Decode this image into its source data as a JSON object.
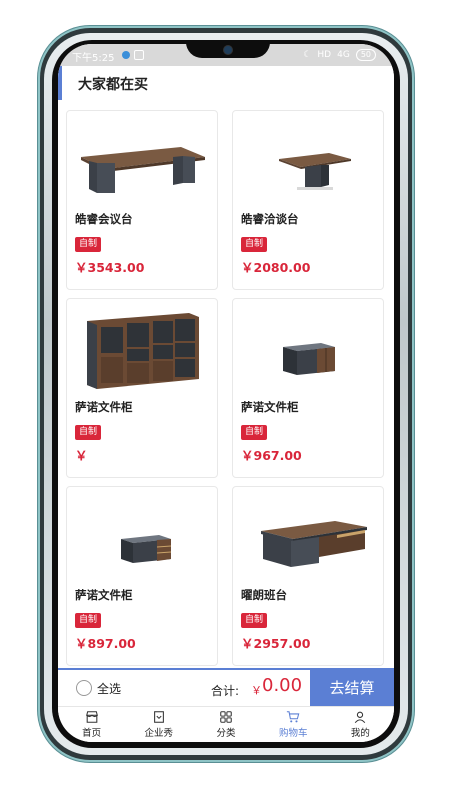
{
  "status_bar": {
    "time": "下午5:25",
    "network": "HD",
    "signal": "4G",
    "battery": "50"
  },
  "section": {
    "title": "大家都在买"
  },
  "products": [
    {
      "name": "皓睿会议台",
      "tag": "自制",
      "price": "￥3543.00",
      "image": "conference-table"
    },
    {
      "name": "皓睿洽谈台",
      "tag": "自制",
      "price": "￥2080.00",
      "image": "meeting-table"
    },
    {
      "name": "萨诺文件柜",
      "tag": "自制",
      "price": "￥",
      "image": "bookcase"
    },
    {
      "name": "萨诺文件柜",
      "tag": "自制",
      "price": "￥967.00",
      "image": "low-cabinet"
    },
    {
      "name": "萨诺文件柜",
      "tag": "自制",
      "price": "￥897.00",
      "image": "mobile-cabinet"
    },
    {
      "name": "曜朗班台",
      "tag": "自制",
      "price": "￥2957.00",
      "image": "executive-desk"
    }
  ],
  "checkout": {
    "select_all": "全选",
    "total_label": "合计:",
    "currency": "￥",
    "total": "0.00",
    "button": "去结算"
  },
  "tabs": [
    {
      "label": "首页",
      "icon": "home-icon"
    },
    {
      "label": "企业秀",
      "icon": "showcase-icon"
    },
    {
      "label": "分类",
      "icon": "category-icon"
    },
    {
      "label": "购物车",
      "icon": "cart-icon",
      "active": true
    },
    {
      "label": "我的",
      "icon": "user-icon"
    }
  ],
  "colors": {
    "accent": "#5b7fd4",
    "price": "#d9263a",
    "tag_bg": "#d9263a"
  }
}
